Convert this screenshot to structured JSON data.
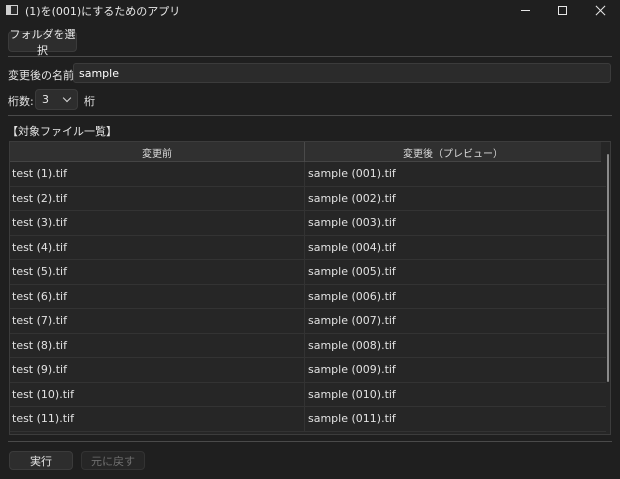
{
  "window": {
    "title": "(1)を(001)にするためのアプリ",
    "controls": {
      "minimize": "minimize-icon",
      "maximize": "maximize-icon",
      "close": "close-icon"
    }
  },
  "toolbar": {
    "select_folder_label": "フォルダを選択"
  },
  "form": {
    "name_label": "変更後の名前:",
    "name_value": "sample",
    "digits_label": "桁数:",
    "digits_value": "3",
    "digits_suffix": "桁"
  },
  "file_list": {
    "section_label": "【対象ファイル一覧】",
    "columns": [
      "変更前",
      "変更後（プレビュー）"
    ],
    "rows": [
      [
        "test (1).tif",
        "sample (001).tif"
      ],
      [
        "test (2).tif",
        "sample (002).tif"
      ],
      [
        "test (3).tif",
        "sample (003).tif"
      ],
      [
        "test (4).tif",
        "sample (004).tif"
      ],
      [
        "test (5).tif",
        "sample (005).tif"
      ],
      [
        "test (6).tif",
        "sample (006).tif"
      ],
      [
        "test (7).tif",
        "sample (007).tif"
      ],
      [
        "test (8).tif",
        "sample (008).tif"
      ],
      [
        "test (9).tif",
        "sample (009).tif"
      ],
      [
        "test (10).tif",
        "sample (010).tif"
      ],
      [
        "test (11).tif",
        "sample (011).tif"
      ]
    ]
  },
  "actions": {
    "run_label": "実行",
    "undo_label": "元に戻す",
    "undo_enabled": false
  }
}
